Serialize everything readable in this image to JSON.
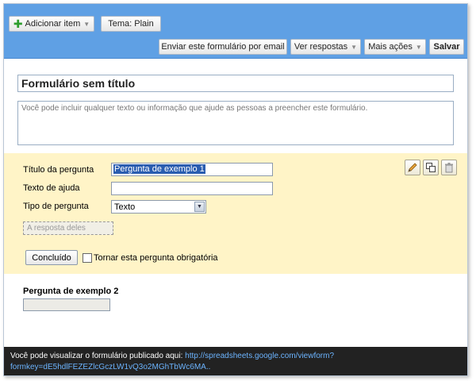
{
  "toolbar": {
    "add_item_label": "Adicionar item",
    "theme_label": "Tema:  Plain",
    "email_form_label": "Enviar este formulário por email",
    "view_responses_label": "Ver respostas",
    "more_actions_label": "Mais ações",
    "save_label": "Salvar"
  },
  "form": {
    "title": "Formulário sem título",
    "description": "Você pode incluir qualquer texto ou informação que ajude as pessoas a preencher este formulário."
  },
  "question_editor": {
    "title_label": "Título da pergunta",
    "title_value": "Pergunta de exemplo 1",
    "help_label": "Texto de ajuda",
    "help_value": "",
    "type_label": "Tipo de pergunta",
    "type_value": "Texto",
    "answer_placeholder": "A resposta deles",
    "done_label": "Concluído",
    "required_label": "Tornar esta pergunta obrigatória",
    "required_checked": false
  },
  "question2": {
    "label": "Pergunta de exemplo 2"
  },
  "footer": {
    "text": "Você pode visualizar o formulário publicado aqui: ",
    "link": "http://spreadsheets.google.com/viewform?formkey=dE5hdlFEZEZlcGczLW1vQ3o2MGhTbWc6MA.."
  },
  "colors": {
    "toolbar_bg": "#5fa0e4",
    "edit_panel_bg": "#fff4c7",
    "footer_bg": "#222222",
    "link": "#6cb4ff"
  }
}
